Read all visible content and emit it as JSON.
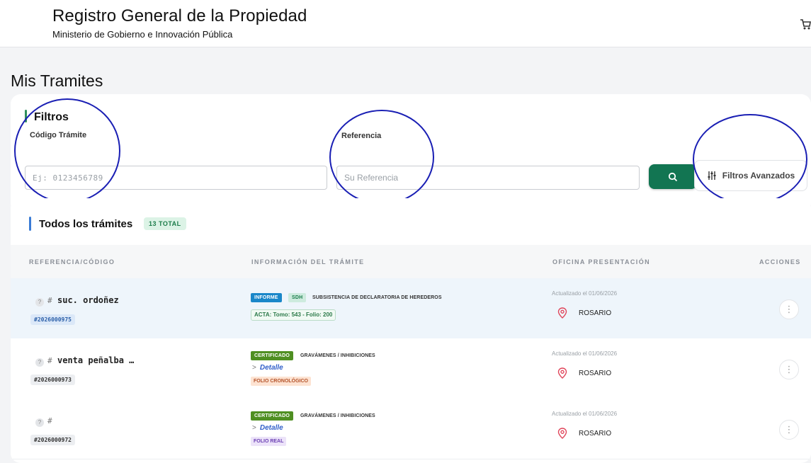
{
  "header": {
    "title": "Registro General de la Propiedad",
    "subtitle": "Ministerio de Gobierno e Innovación Pública",
    "cart_icon": "cart-icon"
  },
  "page_title": "Mis Tramites",
  "filters": {
    "title": "Filtros",
    "code_label": "Código Trámite",
    "code_placeholder": "Ej: 0123456789",
    "code_value": "",
    "ref_label": "Referencia",
    "ref_placeholder": "Su Referencia",
    "ref_value": "",
    "search_icon": "search-icon",
    "advanced_label": "Filtros Avanzados",
    "advanced_icon": "sliders-icon",
    "accent_color": "#127552"
  },
  "list": {
    "title": "Todos los trámites",
    "total_badge": "13 TOTAL",
    "columns": [
      "REFERENCIA/CÓDIGO",
      "INFORMACIÓN DEL TRÁMITE",
      "OFICINA PRESENTACIÓN",
      "ACCIONES"
    ],
    "rows": [
      {
        "help": "?",
        "hash": "#",
        "ref": "suc. ordoñez",
        "code": "#2026000975",
        "badge1": "INFORME",
        "badge2": "SDH",
        "tipo": "SUBSISTENCIA DE DECLARATORIA DE HEREDEROS",
        "acta": "ACTA: Tomo: 543 - Folio: 200",
        "updated": "Actualizado el 01/06/2026",
        "office": "ROSARIO",
        "actions": "⋮"
      },
      {
        "help": "?",
        "hash": "#",
        "ref": "venta peñalba …",
        "code": "#2026000973",
        "badge1": "CERTIFICADO",
        "tipo": "GRAVÁMENES / INHIBICIONES",
        "chevron": ">",
        "detalle": "Detalle",
        "folio": "FOLIO CRONOLÓGICO",
        "updated": "Actualizado el 01/06/2026",
        "office": "ROSARIO",
        "actions": "⋮"
      },
      {
        "help": "?",
        "hash": "#",
        "ref": "",
        "code": "#2026000972",
        "badge1": "CERTIFICADO",
        "tipo": "GRAVÁMENES / INHIBICIONES",
        "chevron": ">",
        "detalle": "Detalle",
        "folio": "FOLIO REAL",
        "updated": "Actualizado el 01/06/2026",
        "office": "ROSARIO",
        "actions": "⋮"
      }
    ]
  },
  "colors": {
    "primary_green": "#127552",
    "annotation_blue": "#1a1fb4",
    "informe_blue": "#1a87c9",
    "certificado_green": "#4f8f22",
    "pin_red": "#e0455a"
  }
}
